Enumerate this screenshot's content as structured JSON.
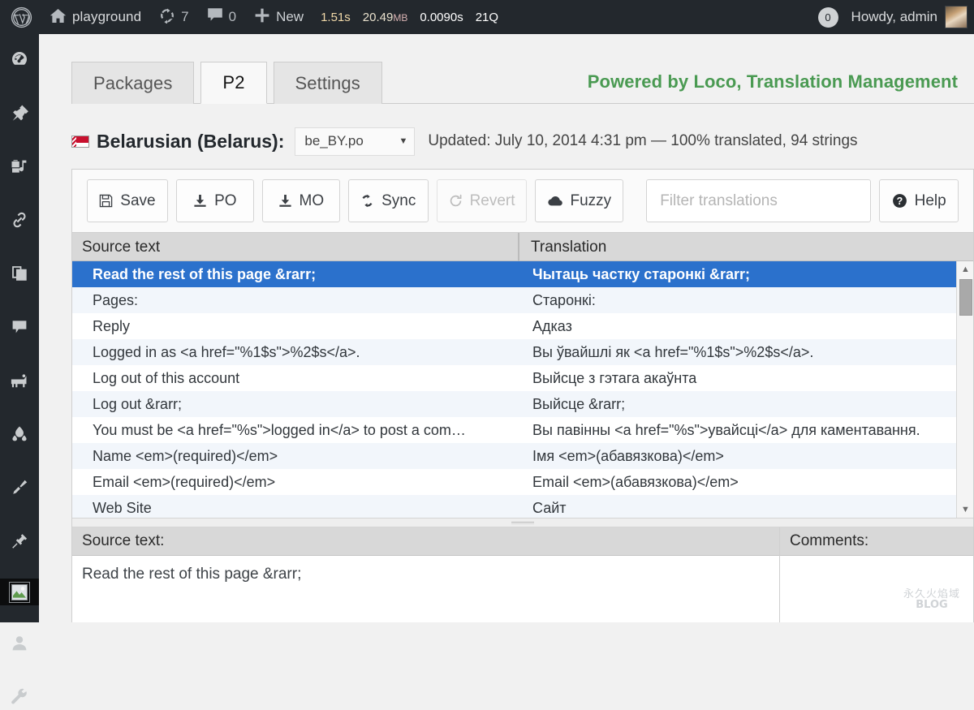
{
  "adminbar": {
    "logo_icon": "wordpress-logo-icon",
    "home_icon": "home-icon",
    "site_name": "playground",
    "updates_icon": "updates-icon",
    "updates_count": "7",
    "comments_icon": "comment-bubble-icon",
    "comments_count": "0",
    "new_icon": "plus-icon",
    "new_label": "New",
    "stats": {
      "time": "1.51s",
      "memory": "20.49",
      "memory_unit": "MB",
      "query_time": "0.0090s",
      "queries": "21Q"
    },
    "notification_count": "0",
    "howdy": "Howdy, admin",
    "avatar": "user-avatar"
  },
  "adminmenu": {
    "items": [
      {
        "icon": "dashboard-icon"
      },
      {
        "icon": "pin-icon"
      },
      {
        "icon": "media-icon"
      },
      {
        "icon": "link-icon"
      },
      {
        "icon": "pages-icon"
      },
      {
        "icon": "comments-icon"
      },
      {
        "icon": "appearance-icon"
      },
      {
        "icon": "plugins-icon"
      },
      {
        "icon": "brush-icon"
      },
      {
        "icon": "plug-icon"
      },
      {
        "icon": "loco-translate-icon"
      },
      {
        "icon": "users-icon"
      },
      {
        "icon": "tools-icon"
      }
    ]
  },
  "tabs": [
    {
      "label": "Packages",
      "active": false
    },
    {
      "label": "P2",
      "active": true
    },
    {
      "label": "Settings",
      "active": false
    }
  ],
  "brand": {
    "text": "Powered by Loco, Translation Management",
    "color": "#4a9a52"
  },
  "language": {
    "flag": "belarus-flag-icon",
    "name": "Belarusian (Belarus):",
    "po_file": "be_BY.po",
    "caret_icon": "chevron-down-icon",
    "updated": "Updated: July 10, 2014 4:31 pm — 100% translated, 94 strings"
  },
  "toolbar": {
    "save": {
      "label": "Save",
      "icon": "floppy-disk-icon"
    },
    "po": {
      "label": "PO",
      "icon": "download-icon"
    },
    "mo": {
      "label": "MO",
      "icon": "download-icon"
    },
    "sync": {
      "label": "Sync",
      "icon": "refresh-icon"
    },
    "revert": {
      "label": "Revert",
      "icon": "revert-icon",
      "disabled": true
    },
    "fuzzy": {
      "label": "Fuzzy",
      "icon": "cloud-icon"
    },
    "filter_placeholder": "Filter translations",
    "filter_value": "",
    "help": {
      "label": "Help",
      "icon": "question-circle-icon"
    }
  },
  "table": {
    "headers": {
      "source": "Source text",
      "translation": "Translation"
    },
    "rows": [
      {
        "source": "Read the rest of this page &rarr;",
        "translation": "Чытаць частку старонкі &rarr;",
        "selected": true
      },
      {
        "source": "Pages:",
        "translation": "Старонкі:",
        "selected": false
      },
      {
        "source": "Reply",
        "translation": "Адказ",
        "selected": false
      },
      {
        "source": "Logged in as <a href=\"%1$s\">%2$s</a>.",
        "translation": "Вы ўвайшлі як <a href=\"%1$s\">%2$s</a>.",
        "selected": false
      },
      {
        "source": "Log out of this account",
        "translation": "Выйсце з гэтага акаўнта",
        "selected": false
      },
      {
        "source": "Log out &rarr;",
        "translation": "Выйсце &rarr;",
        "selected": false
      },
      {
        "source": "You must be <a href=\"%s\">logged in</a> to post a com…",
        "translation": "Вы павінны <a href=\"%s\">увайсці</a> для каментавання.",
        "selected": false
      },
      {
        "source": "Name <em>(required)</em>",
        "translation": "Імя <em>(абавязкова)</em>",
        "selected": false
      },
      {
        "source": "Email <em>(required)</em>",
        "translation": "Email <em>(абавязкова)</em>",
        "selected": false
      },
      {
        "source": "Web Site",
        "translation": "Сайт",
        "selected": false
      }
    ],
    "scrollbar": {
      "up_icon": "scroll-up-arrow-icon",
      "down_icon": "scroll-down-arrow-icon"
    }
  },
  "editor": {
    "source_label": "Source text:",
    "source_value": "Read the rest of this page &rarr;",
    "comments_label": "Comments:",
    "comments_value": ""
  },
  "watermark": {
    "line1": "永久火焰域",
    "line2": "BLOG"
  },
  "colors": {
    "admin_bar": "#23282d",
    "selection": "#2b71cc",
    "brand_green": "#4a9a52",
    "page_bg": "#f1f1f1"
  }
}
